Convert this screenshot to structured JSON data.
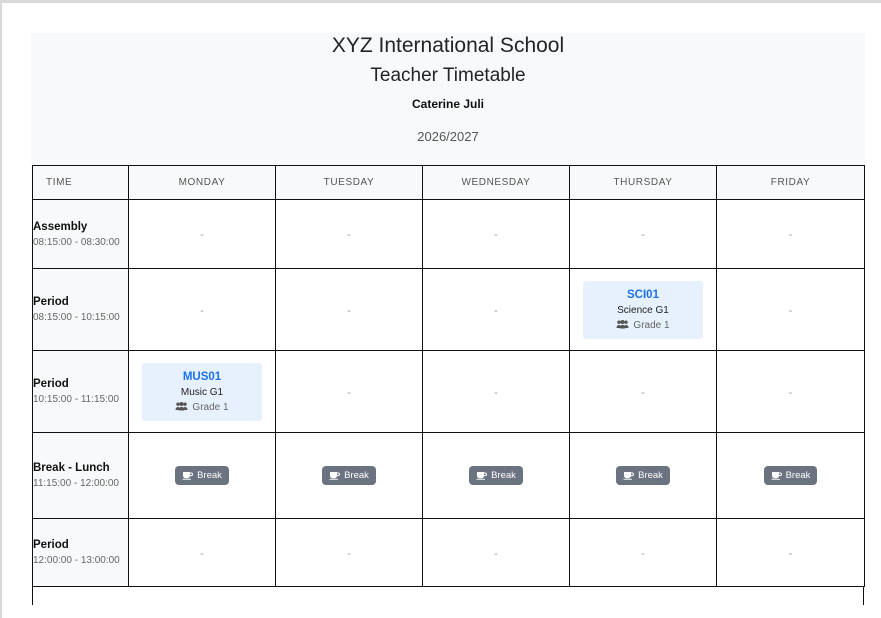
{
  "school_name": "XYZ International School",
  "document_title": "Teacher Timetable",
  "teacher_name": "Caterine Juli",
  "academic_year": "2026/2027",
  "colors": {
    "lesson_background": "#e7f0fd",
    "lesson_code": "#1a73e8",
    "break_badge": "#6b7280",
    "header_background": "#f8f9fa"
  },
  "table": {
    "headers": [
      "TIME",
      "MONDAY",
      "TUESDAY",
      "WEDNESDAY",
      "THURSDAY",
      "FRIDAY"
    ],
    "empty_marker": "-",
    "rows": [
      {
        "slot": "Assembly",
        "time": "08:15:00 - 08:30:00",
        "cells": [
          {
            "type": "empty"
          },
          {
            "type": "empty"
          },
          {
            "type": "empty"
          },
          {
            "type": "empty"
          },
          {
            "type": "empty"
          }
        ]
      },
      {
        "slot": "Period",
        "time": "08:15:00 - 10:15:00",
        "cells": [
          {
            "type": "empty"
          },
          {
            "type": "empty"
          },
          {
            "type": "empty"
          },
          {
            "type": "lesson",
            "code": "SCI01",
            "subject": "Science G1",
            "grade": "Grade 1",
            "icon": "people-icon"
          },
          {
            "type": "empty"
          }
        ]
      },
      {
        "slot": "Period",
        "time": "10:15:00 - 11:15:00",
        "cells": [
          {
            "type": "lesson",
            "code": "MUS01",
            "subject": "Music G1",
            "grade": "Grade 1",
            "icon": "people-icon"
          },
          {
            "type": "empty"
          },
          {
            "type": "empty"
          },
          {
            "type": "empty"
          },
          {
            "type": "empty"
          }
        ]
      },
      {
        "slot": "Break - Lunch",
        "time": "11:15:00 - 12:00:00",
        "cells": [
          {
            "type": "break",
            "label": "Break",
            "icon": "coffee-cup-icon"
          },
          {
            "type": "break",
            "label": "Break",
            "icon": "coffee-cup-icon"
          },
          {
            "type": "break",
            "label": "Break",
            "icon": "coffee-cup-icon"
          },
          {
            "type": "break",
            "label": "Break",
            "icon": "coffee-cup-icon"
          },
          {
            "type": "break",
            "label": "Break",
            "icon": "coffee-cup-icon"
          }
        ]
      },
      {
        "slot": "Period",
        "time": "12:00:00 - 13:00:00",
        "cells": [
          {
            "type": "empty"
          },
          {
            "type": "empty"
          },
          {
            "type": "empty"
          },
          {
            "type": "empty"
          },
          {
            "type": "empty"
          }
        ]
      }
    ]
  }
}
